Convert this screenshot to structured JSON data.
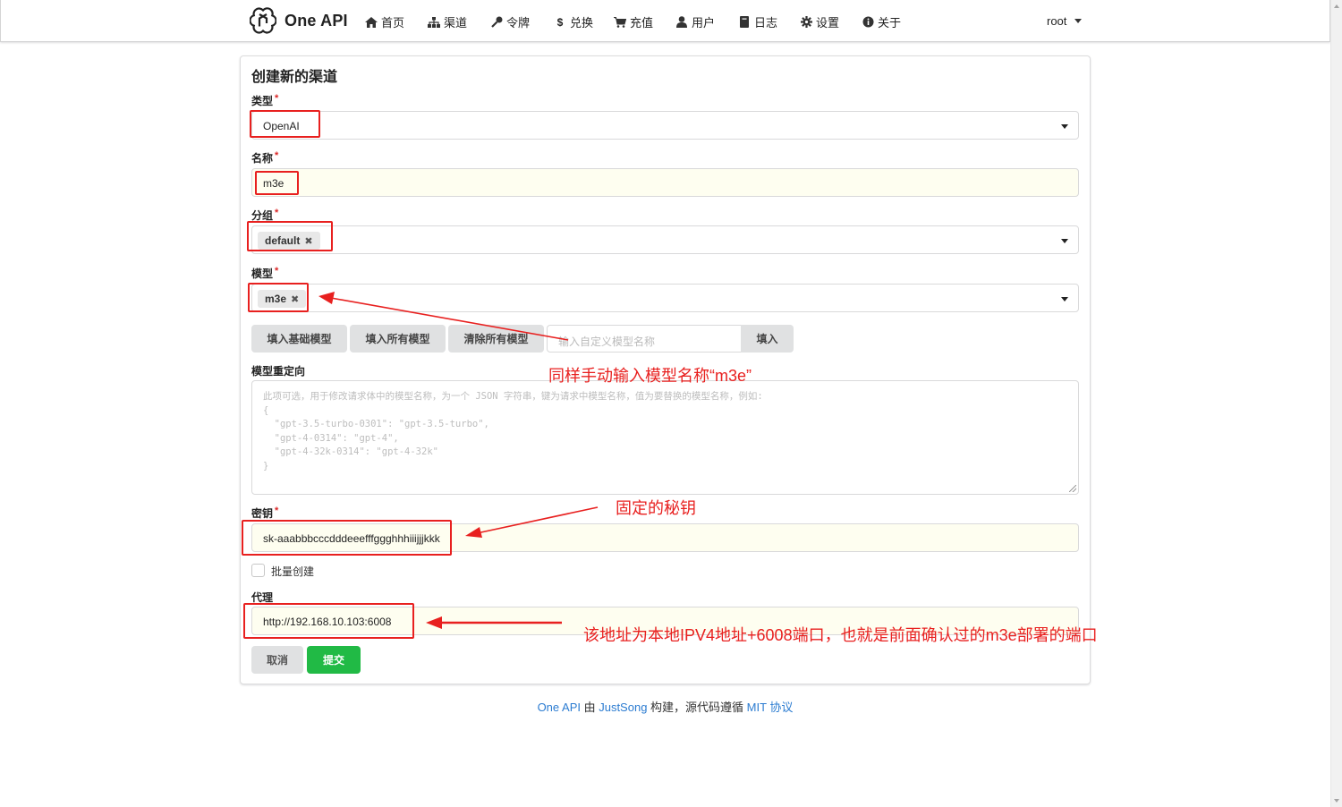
{
  "brand": {
    "name": "One API"
  },
  "nav": {
    "items": [
      {
        "label": "首页",
        "icon": "home-icon"
      },
      {
        "label": "渠道",
        "icon": "sitemap-icon"
      },
      {
        "label": "令牌",
        "icon": "key-icon"
      },
      {
        "label": "兑换",
        "icon": "dollar-icon"
      },
      {
        "label": "充值",
        "icon": "cart-icon"
      },
      {
        "label": "用户",
        "icon": "user-icon"
      },
      {
        "label": "日志",
        "icon": "book-icon"
      },
      {
        "label": "设置",
        "icon": "gear-icon"
      },
      {
        "label": "关于",
        "icon": "info-icon"
      }
    ],
    "user": "root"
  },
  "form": {
    "title": "创建新的渠道",
    "type": {
      "label": "类型",
      "value": "OpenAI"
    },
    "name": {
      "label": "名称",
      "value": "m3e"
    },
    "group": {
      "label": "分组",
      "chip": "default"
    },
    "models": {
      "label": "模型",
      "chip": "m3e"
    },
    "model_buttons": {
      "fill_basic": "填入基础模型",
      "fill_all": "填入所有模型",
      "clear_all": "清除所有模型",
      "custom_placeholder": "输入自定义模型名称",
      "fill": "填入"
    },
    "mapping": {
      "label": "模型重定向",
      "placeholder": "此项可选，用于修改请求体中的模型名称，为一个 JSON 字符串，键为请求中模型名称，值为要替换的模型名称，例如:\n{\n  \"gpt-3.5-turbo-0301\": \"gpt-3.5-turbo\",\n  \"gpt-4-0314\": \"gpt-4\",\n  \"gpt-4-32k-0314\": \"gpt-4-32k\"\n}"
    },
    "key": {
      "label": "密钥",
      "value": "sk-aaabbbcccdddeeefffggghhhiiijjjkkk"
    },
    "batch": {
      "label": "批量创建"
    },
    "proxy": {
      "label": "代理",
      "value": "http://192.168.10.103:6008"
    },
    "cancel": "取消",
    "submit": "提交"
  },
  "footer": {
    "p1": "One API",
    "t1": " 由 ",
    "p2": "JustSong",
    "t2": " 构建，源代码遵循 ",
    "p3": "MIT 协议"
  },
  "annotations": {
    "model_note": "同样手动输入模型名称“m3e”",
    "key_note": "固定的秘钥",
    "proxy_note": "该地址为本地IPV4地址+6008端口，也就是前面确认过的m3e部署的端口",
    "color": "#e8201f"
  },
  "colors": {
    "submit": "#21ba45",
    "link": "#2c7cd1",
    "button": "#e0e1e2"
  }
}
